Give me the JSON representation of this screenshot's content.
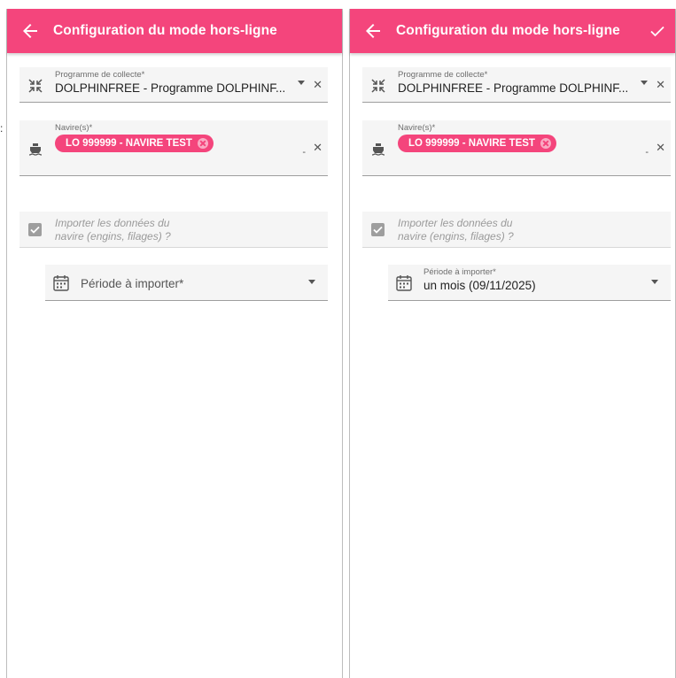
{
  "left_panel": {
    "toolbar": {
      "title": "Configuration du mode hors-ligne"
    },
    "program_field": {
      "label": "Programme de collecte*",
      "value": "DOLPHINFREE - Programme DOLPHINF...",
      "icon": "compress-arrows-icon"
    },
    "ships_field": {
      "label": "Navire(s)*",
      "chip": "LO 999999 - NAVIRE TEST",
      "icon": "boat-icon"
    },
    "import_field": {
      "line1": "Importer les données du",
      "line2": "navire (engins, filages) ?"
    },
    "period_field": {
      "placeholder": "Période à importer*",
      "icon": "calendar-icon"
    }
  },
  "right_panel": {
    "toolbar": {
      "title": "Configuration du mode hors-ligne"
    },
    "program_field": {
      "label": "Programme de collecte*",
      "value": "DOLPHINFREE - Programme DOLPHINF...",
      "icon": "compress-arrows-icon"
    },
    "ships_field": {
      "label": "Navire(s)*",
      "chip": "LO 999999 - NAVIRE TEST",
      "icon": "boat-icon"
    },
    "import_field": {
      "line1": "Importer les données du",
      "line2": "navire (engins, filages) ?"
    },
    "period_field": {
      "label": "Période à importer*",
      "value": "un mois (09/11/2025)",
      "icon": "calendar-icon"
    }
  },
  "colors": {
    "accent": "#f4457c",
    "field_bg": "#f5f5f5"
  },
  "icons": {
    "back": "arrow-left-icon",
    "save": "check-icon",
    "clear": "close-icon",
    "dropdown": "caret-down-icon",
    "checkbox": "checkbox-checked-icon"
  }
}
